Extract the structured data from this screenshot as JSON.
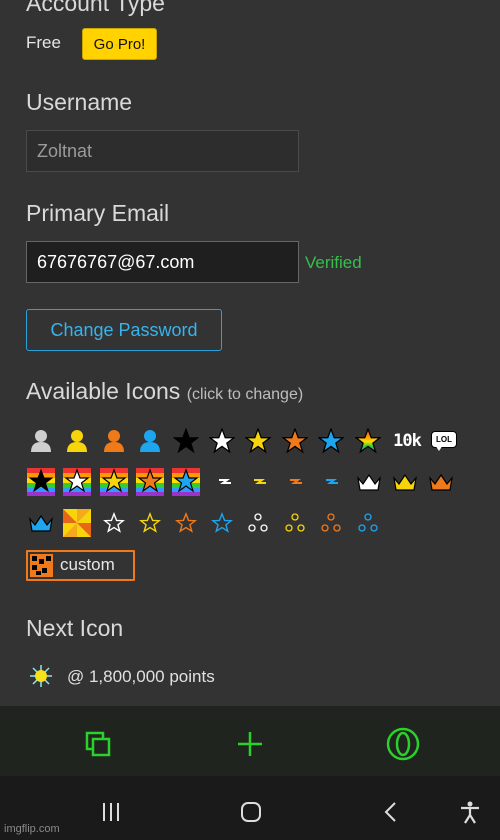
{
  "account": {
    "section_title": "Account Type",
    "plan": "Free",
    "go_pro_label": "Go Pro!"
  },
  "username": {
    "section_title": "Username",
    "value": "Zoltnat"
  },
  "email": {
    "section_title": "Primary Email",
    "value": "67676767@67.com",
    "status": "Verified"
  },
  "change_password_label": "Change Password",
  "icons": {
    "section_title": "Available Icons",
    "hint": "(click to change)",
    "text_icon_10k": "10k",
    "text_icon_lol": "LOL",
    "custom_label": "custom",
    "colors": {
      "gray": "#cfcfcf",
      "yellow": "#f6d60a",
      "orange": "#f07a1a",
      "blue": "#1ea5f0",
      "black": "#000000",
      "white": "#ffffff",
      "custom_border": "#f07a1a"
    }
  },
  "next_icon": {
    "section_title": "Next Icon",
    "points": "@ 1,800,000 points"
  },
  "bottom_nav": {
    "accent_color": "#2bd02b",
    "items": [
      "tabs-icon",
      "add-icon",
      "opera-icon"
    ]
  },
  "system_nav": {
    "items": [
      "recent-apps-icon",
      "home-icon",
      "back-icon",
      "accessibility-icon"
    ]
  },
  "watermark": "imgflip.com"
}
